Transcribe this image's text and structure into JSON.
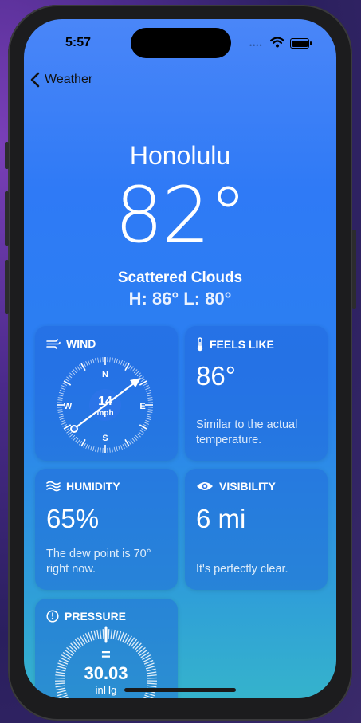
{
  "status_bar": {
    "time": "5:57"
  },
  "nav": {
    "back_label": "Weather"
  },
  "location": {
    "city": "Honolulu",
    "temperature": "82°",
    "condition": "Scattered Clouds",
    "high_low": "H: 86°  L: 80°"
  },
  "cards": {
    "wind": {
      "title": "WIND",
      "speed": "14",
      "unit": "mph",
      "directions": {
        "n": "N",
        "e": "E",
        "s": "S",
        "w": "W"
      }
    },
    "feels_like": {
      "title": "FEELS LIKE",
      "value": "86°",
      "description": "Similar to the actual temperature."
    },
    "humidity": {
      "title": "HUMIDITY",
      "value": "65%",
      "description": "The dew point is 70° right now."
    },
    "visibility": {
      "title": "VISIBILITY",
      "value": "6 mi",
      "description": "It's perfectly clear."
    },
    "pressure": {
      "title": "PRESSURE",
      "symbol": "=",
      "value": "30.03",
      "unit": "inHg"
    }
  }
}
